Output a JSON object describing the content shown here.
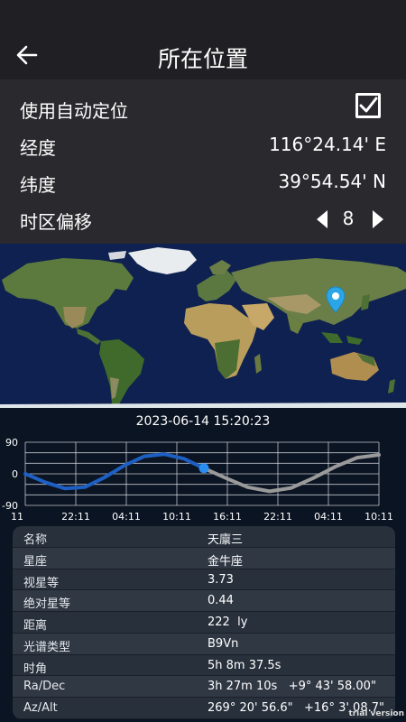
{
  "header": {
    "title": "所在位置"
  },
  "settings": {
    "auto_location": {
      "label": "使用自动定位",
      "checked": true
    },
    "longitude": {
      "label": "经度",
      "value": "116°24.14' E"
    },
    "latitude": {
      "label": "纬度",
      "value": "39°54.54' N"
    },
    "timezone": {
      "label": "时区偏移",
      "value": "8"
    }
  },
  "chart_data": {
    "type": "line",
    "title": "2023-06-14 15:20:23",
    "xlabel": "",
    "ylabel": "",
    "y_ticks": [
      "90",
      "0",
      "-90"
    ],
    "ylim": [
      -90,
      90
    ],
    "x_ticks": [
      "11",
      "22:11",
      "04:11",
      "10:11",
      "16:11",
      "22:11",
      "04:11",
      "10:11"
    ],
    "series": [
      {
        "values": [
          0,
          -24,
          -42,
          -38,
          -10,
          24,
          50,
          56,
          43,
          16
        ]
      },
      {
        "values": [
          16,
          -12,
          -38,
          -50,
          -40,
          -12,
          20,
          46,
          54
        ]
      }
    ],
    "current_marker": {
      "x": "15:20",
      "y": 16
    },
    "colors": {
      "past": "#1e5fc4",
      "future": "#9a9a9a",
      "marker": "#2a8ef0"
    }
  },
  "info": {
    "rows": [
      {
        "key": "名称",
        "value": "天廪三"
      },
      {
        "key": "星座",
        "value": "金牛座"
      },
      {
        "key": "视星等",
        "value": "3.73"
      },
      {
        "key": "绝对星等",
        "value": "0.44"
      },
      {
        "key": "距离",
        "value": "222  ly"
      },
      {
        "key": "光谱类型",
        "value": "B9Vn"
      },
      {
        "key": "时角",
        "value": "5h 8m 37.5s"
      },
      {
        "key": "Ra/Dec",
        "value": "3h 27m 10s   +9° 43' 58.00\""
      },
      {
        "key": "Az/Alt",
        "value": "269° 20' 56.6\"   +16° 3' 08.7\""
      }
    ]
  },
  "watermark": "trial version"
}
